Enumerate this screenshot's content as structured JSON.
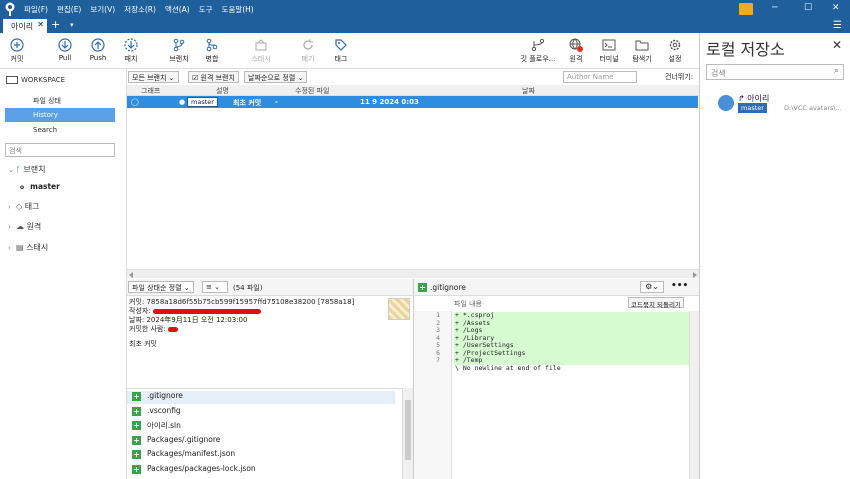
{
  "menu": [
    "파일(F)",
    "편집(E)",
    "보기(V)",
    "저장소(R)",
    "액션(A)",
    "도구",
    "도움말(H)"
  ],
  "tab": {
    "label": "아이리"
  },
  "toolbar": {
    "commit": "커밋",
    "pull": "Pull",
    "push": "Push",
    "fetch": "패치",
    "branch": "브랜치",
    "merge": "병합",
    "stash": "스태시",
    "discard": "폐기",
    "tag": "태그",
    "gitflow": "깃 플로우...",
    "remote": "원격",
    "terminal": "터미널",
    "explorer": "탐색기",
    "settings": "설정"
  },
  "sidebar": {
    "workspace": "WORKSPACE",
    "file_status": "파일 상태",
    "history": "History",
    "search": "Search",
    "search_placeholder": "검색",
    "branches": "브랜치",
    "master": "master",
    "tags": "태그",
    "remotes": "원격",
    "stashes": "스태시"
  },
  "filters": {
    "all_branches": "모든 브랜치",
    "remote_branches": "원격 브랜치",
    "sort_by_date": "날짜순으로 정렬",
    "author_placeholder": "Author Name",
    "jump_to": "건너뛰기:"
  },
  "columns": {
    "graph": "그래프",
    "description": "설명",
    "modified_file": "수정된 파일",
    "date": "날짜"
  },
  "commit_row": {
    "branch": "master",
    "message": "최초 커밋",
    "modified": "-",
    "date": "11 9 2024 0:03"
  },
  "lower": {
    "sort": "파일 상태순 정렬",
    "count": "(54 파일)"
  },
  "details": {
    "commit_line": "커밋: 7858a18d6f55b75cb599f15957ffd75108e38200 [7858a18]",
    "author_label": "작성자:",
    "date_line": "날짜: 2024年9月11日 오전 12:03:00",
    "committer_label": "커밋한 사람:",
    "message": "최초 커밋"
  },
  "files": [
    ".gitignore",
    ".vsconfig",
    "아이리.sln",
    "Packages/.gitignore",
    "Packages/manifest.json",
    "Packages/packages-lock.json"
  ],
  "diff": {
    "filename": ".gitignore",
    "hunk_label": "파일 내용",
    "revert": "코드묶지 되돌리기",
    "lines": [
      {
        "n": "1",
        "t": "+ *.csproj",
        "add": true
      },
      {
        "n": "2",
        "t": "+ /Assets",
        "add": true
      },
      {
        "n": "3",
        "t": "+ /Logs",
        "add": true
      },
      {
        "n": "4",
        "t": "+ /Library",
        "add": true
      },
      {
        "n": "5",
        "t": "+ /UserSettings",
        "add": true
      },
      {
        "n": "6",
        "t": "+ /ProjectSettings",
        "add": true
      },
      {
        "n": "7",
        "t": "+ /Temp",
        "add": true
      },
      {
        "n": "",
        "t": "\\  No newline at end of file",
        "add": false
      }
    ]
  },
  "right_panel": {
    "title": "로컬 저장소",
    "search_placeholder": "검색",
    "repo_name": "아이리",
    "repo_branch": "master",
    "repo_path": "D:\\VCC avatars\\..."
  }
}
